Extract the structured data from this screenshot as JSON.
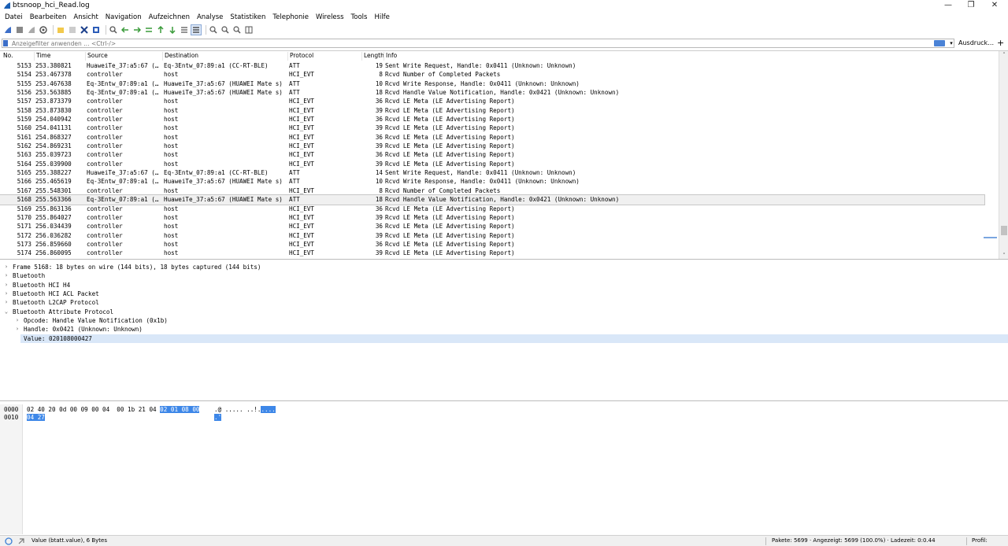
{
  "window": {
    "title": "btsnoop_hci_Read.log",
    "controls": {
      "minimize": "—",
      "restore": "❐",
      "close": "✕"
    }
  },
  "menu": [
    "Datei",
    "Bearbeiten",
    "Ansicht",
    "Navigation",
    "Aufzeichnen",
    "Analyse",
    "Statistiken",
    "Telephonie",
    "Wireless",
    "Tools",
    "Hilfe"
  ],
  "filter": {
    "placeholder": "Anzeigefilter anwenden … <Ctrl-/>",
    "expression_label": "Ausdruck…",
    "add_label": "+"
  },
  "packet_list": {
    "columns": [
      "No.",
      "Time",
      "Source",
      "Destination",
      "Protocol",
      "Length",
      "Info"
    ],
    "rows": [
      {
        "no": "5153",
        "time": "253.380821",
        "src": "HuaweiTe_37:a5:67 (…",
        "dst": "Eq-3Entw_07:89:a1 (CC-RT-BLE)",
        "proto": "ATT",
        "len": "19",
        "info": "Sent Write Request, Handle: 0x0411 (Unknown: Unknown)"
      },
      {
        "no": "5154",
        "time": "253.467378",
        "src": "controller",
        "dst": "host",
        "proto": "HCI_EVT",
        "len": "8",
        "info": "Rcvd Number of Completed Packets"
      },
      {
        "no": "5155",
        "time": "253.467638",
        "src": "Eq-3Entw_07:89:a1 (…",
        "dst": "HuaweiTe_37:a5:67 (HUAWEI Mate s)",
        "proto": "ATT",
        "len": "10",
        "info": "Rcvd Write Response, Handle: 0x0411 (Unknown: Unknown)"
      },
      {
        "no": "5156",
        "time": "253.563885",
        "src": "Eq-3Entw_07:89:a1 (…",
        "dst": "HuaweiTe_37:a5:67 (HUAWEI Mate s)",
        "proto": "ATT",
        "len": "18",
        "info": "Rcvd Handle Value Notification, Handle: 0x0421 (Unknown: Unknown)"
      },
      {
        "no": "5157",
        "time": "253.873379",
        "src": "controller",
        "dst": "host",
        "proto": "HCI_EVT",
        "len": "36",
        "info": "Rcvd LE Meta (LE Advertising Report)"
      },
      {
        "no": "5158",
        "time": "253.873830",
        "src": "controller",
        "dst": "host",
        "proto": "HCI_EVT",
        "len": "39",
        "info": "Rcvd LE Meta (LE Advertising Report)"
      },
      {
        "no": "5159",
        "time": "254.040942",
        "src": "controller",
        "dst": "host",
        "proto": "HCI_EVT",
        "len": "36",
        "info": "Rcvd LE Meta (LE Advertising Report)"
      },
      {
        "no": "5160",
        "time": "254.041131",
        "src": "controller",
        "dst": "host",
        "proto": "HCI_EVT",
        "len": "39",
        "info": "Rcvd LE Meta (LE Advertising Report)"
      },
      {
        "no": "5161",
        "time": "254.868327",
        "src": "controller",
        "dst": "host",
        "proto": "HCI_EVT",
        "len": "36",
        "info": "Rcvd LE Meta (LE Advertising Report)"
      },
      {
        "no": "5162",
        "time": "254.869231",
        "src": "controller",
        "dst": "host",
        "proto": "HCI_EVT",
        "len": "39",
        "info": "Rcvd LE Meta (LE Advertising Report)"
      },
      {
        "no": "5163",
        "time": "255.039723",
        "src": "controller",
        "dst": "host",
        "proto": "HCI_EVT",
        "len": "36",
        "info": "Rcvd LE Meta (LE Advertising Report)"
      },
      {
        "no": "5164",
        "time": "255.039900",
        "src": "controller",
        "dst": "host",
        "proto": "HCI_EVT",
        "len": "39",
        "info": "Rcvd LE Meta (LE Advertising Report)"
      },
      {
        "no": "5165",
        "time": "255.388227",
        "src": "HuaweiTe_37:a5:67 (…",
        "dst": "Eq-3Entw_07:89:a1 (CC-RT-BLE)",
        "proto": "ATT",
        "len": "14",
        "info": "Sent Write Request, Handle: 0x0411 (Unknown: Unknown)"
      },
      {
        "no": "5166",
        "time": "255.465619",
        "src": "Eq-3Entw_07:89:a1 (…",
        "dst": "HuaweiTe_37:a5:67 (HUAWEI Mate s)",
        "proto": "ATT",
        "len": "10",
        "info": "Rcvd Write Response, Handle: 0x0411 (Unknown: Unknown)"
      },
      {
        "no": "5167",
        "time": "255.548301",
        "src": "controller",
        "dst": "host",
        "proto": "HCI_EVT",
        "len": "8",
        "info": "Rcvd Number of Completed Packets"
      },
      {
        "no": "5168",
        "time": "255.563366",
        "src": "Eq-3Entw_07:89:a1 (…",
        "dst": "HuaweiTe_37:a5:67 (HUAWEI Mate s)",
        "proto": "ATT",
        "len": "18",
        "info": "Rcvd Handle Value Notification, Handle: 0x0421 (Unknown: Unknown)",
        "selected": true
      },
      {
        "no": "5169",
        "time": "255.863136",
        "src": "controller",
        "dst": "host",
        "proto": "HCI_EVT",
        "len": "36",
        "info": "Rcvd LE Meta (LE Advertising Report)"
      },
      {
        "no": "5170",
        "time": "255.864027",
        "src": "controller",
        "dst": "host",
        "proto": "HCI_EVT",
        "len": "39",
        "info": "Rcvd LE Meta (LE Advertising Report)"
      },
      {
        "no": "5171",
        "time": "256.034439",
        "src": "controller",
        "dst": "host",
        "proto": "HCI_EVT",
        "len": "36",
        "info": "Rcvd LE Meta (LE Advertising Report)"
      },
      {
        "no": "5172",
        "time": "256.036282",
        "src": "controller",
        "dst": "host",
        "proto": "HCI_EVT",
        "len": "39",
        "info": "Rcvd LE Meta (LE Advertising Report)"
      },
      {
        "no": "5173",
        "time": "256.859660",
        "src": "controller",
        "dst": "host",
        "proto": "HCI_EVT",
        "len": "36",
        "info": "Rcvd LE Meta (LE Advertising Report)"
      },
      {
        "no": "5174",
        "time": "256.860095",
        "src": "controller",
        "dst": "host",
        "proto": "HCI_EVT",
        "len": "39",
        "info": "Rcvd LE Meta (LE Advertising Report)"
      }
    ]
  },
  "details": [
    {
      "label": "Frame 5168: 18 bytes on wire (144 bits), 18 bytes captured (144 bits)",
      "arrow": ">",
      "level": 0
    },
    {
      "label": "Bluetooth",
      "arrow": ">",
      "level": 0
    },
    {
      "label": "Bluetooth HCI H4",
      "arrow": ">",
      "level": 0
    },
    {
      "label": "Bluetooth HCI ACL Packet",
      "arrow": ">",
      "level": 0
    },
    {
      "label": "Bluetooth L2CAP Protocol",
      "arrow": ">",
      "level": 0
    },
    {
      "label": "Bluetooth Attribute Protocol",
      "arrow": "v",
      "level": 0
    },
    {
      "label": "Opcode: Handle Value Notification (0x1b)",
      "arrow": ">",
      "level": 1
    },
    {
      "label": "Handle: 0x0421 (Unknown: Unknown)",
      "arrow": ">",
      "level": 1
    },
    {
      "label": "Value: 020108000427",
      "arrow": "",
      "level": 1,
      "selected": true
    }
  ],
  "bytes": [
    {
      "offset": "0000",
      "hex_plain": "02 40 20 0d 00 09 00 04  00 1b 21 04 ",
      "hex_hl": "02 01 08 00",
      "ascii_plain": ".@ ..... ..!.",
      "ascii_hl": "...."
    },
    {
      "offset": "0010",
      "hex_plain": "",
      "hex_hl": "04 27",
      "ascii_plain": "",
      "ascii_hl": ".'"
    }
  ],
  "status": {
    "field": "Value (btatt.value), 6 Bytes",
    "packets": "Pakete: 5699 · Angezeigt: 5699 (100.0%) · Ladezeit: 0:0.44",
    "profile": "Profil: Default"
  },
  "colors": {
    "accent": "#3d87e8",
    "selected_row": "#f0f0f0",
    "selected_tree": "#d9e7f8"
  }
}
